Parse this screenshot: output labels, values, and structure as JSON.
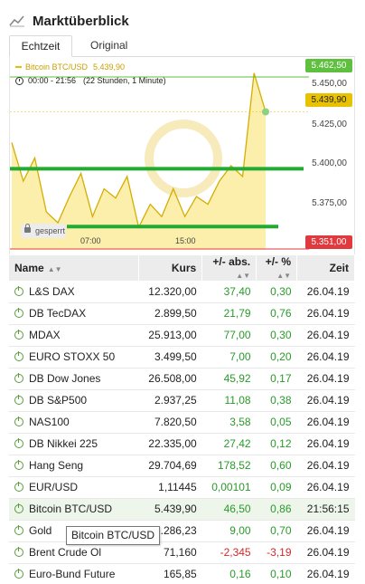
{
  "header": {
    "title": "Marktüberblick"
  },
  "tabs": [
    {
      "label": "Echtzeit"
    },
    {
      "label": "Original"
    }
  ],
  "chart": {
    "series_name": "Bitcoin BTC/USD",
    "series_value": "5.439,90",
    "time_range": "00:00 - 21:56",
    "duration": "(22 Stunden, 1 Minute)",
    "high_tag": "5.462,50",
    "current_tag": "5.439,90",
    "low_tag": "5.351,00",
    "y_ticks": [
      "5.450,00",
      "5.425,00",
      "5.400,00",
      "5.375,00"
    ],
    "x_ticks": [
      "07:00",
      "15:00"
    ],
    "locked_label": "gesperrt",
    "colors": {
      "line": "#d4ad00",
      "fill": "#fbe990",
      "support": "#22aa33",
      "high": "#5fbf3f",
      "low": "#e0393e"
    }
  },
  "chart_data": {
    "type": "area",
    "title": "Bitcoin BTC/USD",
    "x": [
      "00:00",
      "01:00",
      "02:00",
      "03:00",
      "04:00",
      "05:00",
      "06:00",
      "07:00",
      "08:00",
      "09:00",
      "10:00",
      "11:00",
      "12:00",
      "13:00",
      "14:00",
      "15:00",
      "16:00",
      "17:00",
      "18:00",
      "19:00",
      "20:00",
      "21:00",
      "21:56"
    ],
    "values": [
      5420,
      5395,
      5410,
      5375,
      5368,
      5385,
      5400,
      5372,
      5390,
      5384,
      5398,
      5365,
      5380,
      5372,
      5390,
      5372,
      5385,
      5380,
      5395,
      5405,
      5398,
      5465,
      5439.9
    ],
    "ylim": [
      5351,
      5462.5
    ],
    "high": 5462.5,
    "low": 5351.0,
    "current": 5439.9
  },
  "table": {
    "headers": [
      "Name",
      "Kurs",
      "+/- abs.",
      "+/- %",
      "Zeit"
    ],
    "rows": [
      {
        "name": "L&S DAX",
        "kurs": "12.320,00",
        "abs": "37,40",
        "pct": "0,30",
        "zeit": "26.04.19",
        "dir": "pos"
      },
      {
        "name": "DB TecDAX",
        "kurs": "2.899,50",
        "abs": "21,79",
        "pct": "0,76",
        "zeit": "26.04.19",
        "dir": "pos"
      },
      {
        "name": "MDAX",
        "kurs": "25.913,00",
        "abs": "77,00",
        "pct": "0,30",
        "zeit": "26.04.19",
        "dir": "pos"
      },
      {
        "name": "EURO STOXX 50",
        "kurs": "3.499,50",
        "abs": "7,00",
        "pct": "0,20",
        "zeit": "26.04.19",
        "dir": "pos"
      },
      {
        "name": "DB Dow Jones",
        "kurs": "26.508,00",
        "abs": "45,92",
        "pct": "0,17",
        "zeit": "26.04.19",
        "dir": "pos"
      },
      {
        "name": "DB S&P500",
        "kurs": "2.937,25",
        "abs": "11,08",
        "pct": "0,38",
        "zeit": "26.04.19",
        "dir": "pos"
      },
      {
        "name": "NAS100",
        "kurs": "7.820,50",
        "abs": "3,58",
        "pct": "0,05",
        "zeit": "26.04.19",
        "dir": "pos"
      },
      {
        "name": "DB Nikkei 225",
        "kurs": "22.335,00",
        "abs": "27,42",
        "pct": "0,12",
        "zeit": "26.04.19",
        "dir": "pos"
      },
      {
        "name": "Hang Seng",
        "kurs": "29.704,69",
        "abs": "178,52",
        "pct": "0,60",
        "zeit": "26.04.19",
        "dir": "pos"
      },
      {
        "name": "EUR/USD",
        "kurs": "1,11445",
        "abs": "0,00101",
        "pct": "0,09",
        "zeit": "26.04.19",
        "dir": "pos"
      },
      {
        "name": "Bitcoin BTC/USD",
        "kurs": "5.439,90",
        "abs": "46,50",
        "pct": "0,86",
        "zeit": "21:56:15",
        "dir": "pos"
      },
      {
        "name": "Gold",
        "kurs": "1.286,23",
        "abs": "9,00",
        "pct": "0,70",
        "zeit": "26.04.19",
        "dir": "pos"
      },
      {
        "name": "Brent Crude Ol",
        "kurs": "71,160",
        "abs": "-2,345",
        "pct": "-3,19",
        "zeit": "26.04.19",
        "dir": "neg"
      },
      {
        "name": "Euro-Bund Future",
        "kurs": "165,85",
        "abs": "0,16",
        "pct": "0,10",
        "zeit": "26.04.19",
        "dir": "pos"
      }
    ]
  },
  "tooltip": {
    "text": "Bitcoin BTC/USD"
  }
}
